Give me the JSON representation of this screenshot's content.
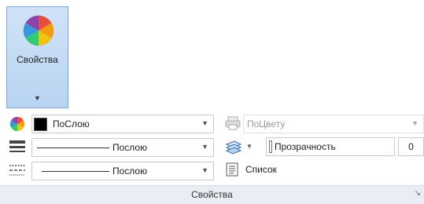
{
  "ribbon": {
    "big_button": {
      "label": "Свойства",
      "icon": "color-wheel-icon"
    },
    "color": {
      "icon": "color-wheel-icon",
      "swatch": "#000000",
      "value": "ПоСлою"
    },
    "lineweight": {
      "icon": "lineweight-icon",
      "value": "Послою"
    },
    "linetype": {
      "icon": "linetype-icon",
      "value": "Послою"
    },
    "plot_style": {
      "icon": "plot-style-icon",
      "value": "ПоЦвету"
    },
    "transparency": {
      "icon": "transparency-icon",
      "label": "Прозрачность",
      "value": "0"
    },
    "list": {
      "icon": "list-icon",
      "label": "Список"
    },
    "panel": {
      "title": "Свойства",
      "launcher_icon": "dialog-launcher-icon"
    }
  },
  "colors": {
    "button_active": "#b8d4f1",
    "border": "#7fa7d6",
    "panel_footer": "#e9eef4"
  }
}
